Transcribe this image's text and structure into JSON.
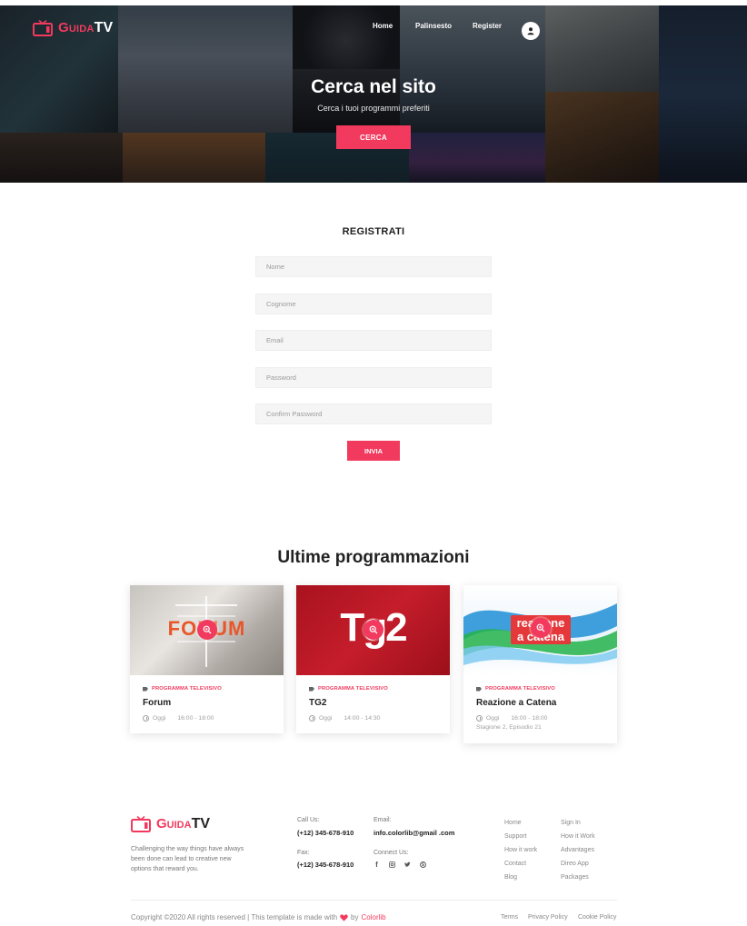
{
  "colors": {
    "accent": "#f23a5e",
    "dark": "#222222",
    "muted": "#888888",
    "field_bg": "#f5f5f5"
  },
  "brand": {
    "name_a": "Guida",
    "name_b": "TV"
  },
  "nav": {
    "home": "Home",
    "palinsesto": "Palinsesto",
    "register": "Register",
    "user_icon": "user-icon"
  },
  "hero": {
    "title": "Cerca nel sito",
    "subtitle": "Cerca i tuoi programmi preferiti",
    "button": "CERCA"
  },
  "register": {
    "title": "REGISTRATI",
    "fields": {
      "nome": "Nome",
      "cognome": "Cognome",
      "email": "Email",
      "password": "Password",
      "confirm": "Confirm Password"
    },
    "submit": "INVIA"
  },
  "programs": {
    "title": "Ultime programmazioni",
    "items": [
      {
        "category": "PROGRAMMA TELEVISIVO",
        "name": "Forum",
        "day": "Oggi",
        "time": "16:00 - 18:00",
        "extra": "",
        "thumb_text": "FORUM"
      },
      {
        "category": "PROGRAMMA TELEVISIVO",
        "name": "TG2",
        "day": "Oggi",
        "time": "14:00 - 14:30",
        "extra": "",
        "thumb_text": "Tg2"
      },
      {
        "category": "PROGRAMMA TELEVISIVO",
        "name": "Reazione a Catena",
        "day": "Oggi",
        "time": "16:00 - 18:00",
        "extra": "Stagione 2, Episodio 21",
        "thumb_text": "reazione a catena"
      }
    ]
  },
  "footer": {
    "tagline": "Challenging the way things have always been done can lead to creative new options that reward you.",
    "call_label": "Call Us:",
    "call_value": "(+12) 345-678-910",
    "fax_label": "Fax:",
    "fax_value": "(+12) 345-678-910",
    "email_label": "Email:",
    "email_value": "info.colorlib@gmail .com",
    "connect_label": "Connect Us:",
    "social_icons": [
      "facebook-icon",
      "instagram-icon",
      "twitter-icon",
      "skype-icon"
    ],
    "links_col1": [
      "Home",
      "Support",
      "How it work",
      "Contact",
      "Blog"
    ],
    "links_col2": [
      "Sign In",
      "How it Work",
      "Advantages",
      "Direo App",
      "Packages"
    ],
    "copyright_a": "Copyright ©2020 All rights reserved | This template is made with",
    "copyright_b": "by",
    "copyright_c": "Colorlib",
    "bottom_links": [
      "Terms",
      "Privacy Policy",
      "Cookie Policy"
    ]
  }
}
